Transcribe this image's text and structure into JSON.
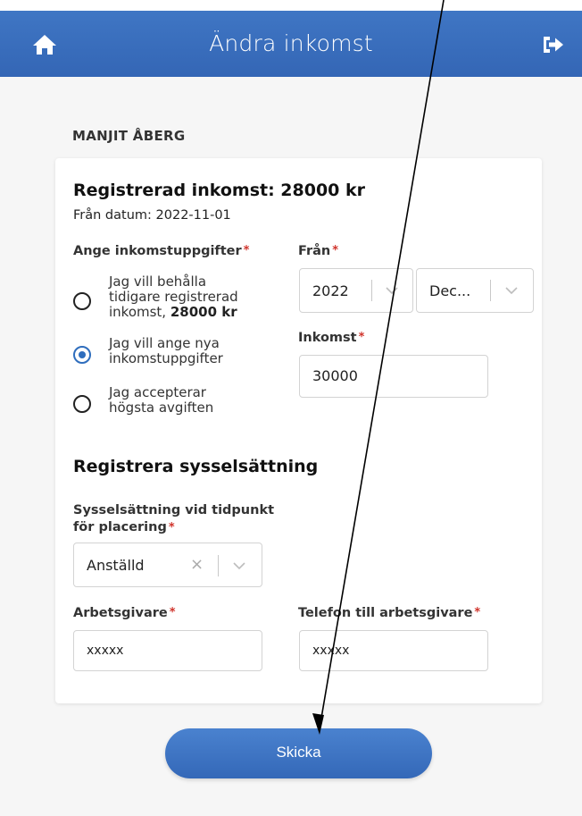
{
  "header": {
    "title": "Ändra inkomst",
    "home_icon": "home-icon",
    "logout_icon": "logout-icon",
    "color": "#3a6ebd"
  },
  "person_name": "MANJIT ÅBERG",
  "income": {
    "registered_label": "Registrerad inkomst: 28000 kr",
    "from_date": "Från datum: 2022-11-01"
  },
  "income_choice": {
    "label": "Ange inkomstuppgifter",
    "required_mark": "*",
    "options": [
      {
        "line1": "Jag vill behålla",
        "line2": "tidigare registrerad",
        "line3_prefix": "inkomst,",
        "line3_bold": "28000 kr",
        "selected": false
      },
      {
        "line1": "Jag vill ange nya",
        "line2": "inkomstuppgifter",
        "selected": true
      },
      {
        "line1": "Jag accepterar",
        "line2": "högsta avgiften",
        "selected": false
      }
    ]
  },
  "from": {
    "label": "Från",
    "required_mark": "*",
    "year_value": "2022",
    "month_value": "Dec..."
  },
  "new_income": {
    "label": "Inkomst",
    "required_mark": "*",
    "value": "30000"
  },
  "employment": {
    "section_title": "Registrera sysselsättning",
    "field_label_line1": "Sysselsättning vid tidpunkt",
    "field_label_line2": "för placering",
    "required_mark": "*",
    "value": "Anställd"
  },
  "employer": {
    "label": "Arbetsgivare",
    "required_mark": "*",
    "value": "xxxxx"
  },
  "employer_phone": {
    "label": "Telefon till arbetsgivare",
    "required_mark": "*",
    "value": "xxxxx"
  },
  "submit_label": "Skicka",
  "accent_color": "#2f6ebd",
  "required_color": "#d0342c"
}
